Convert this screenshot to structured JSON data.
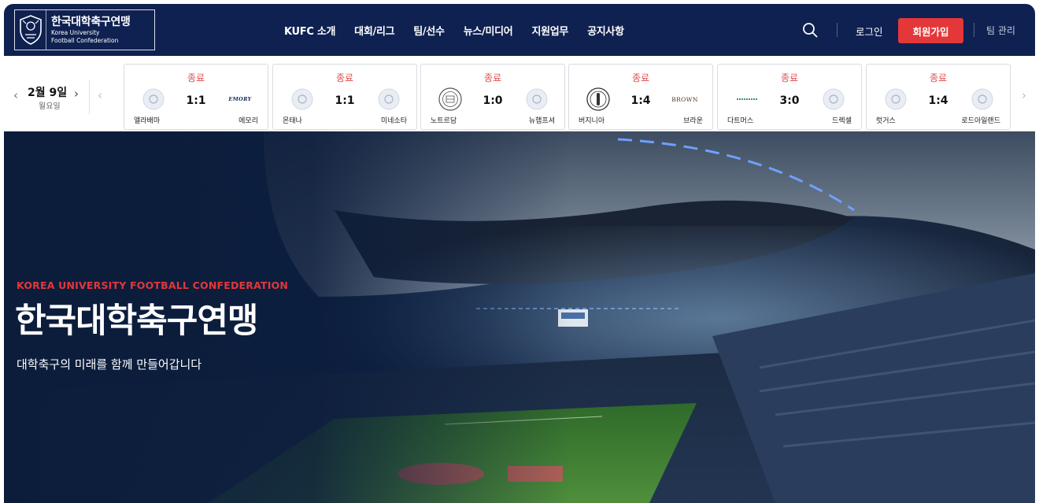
{
  "header": {
    "logo": {
      "name_ko": "한국대학축구연맹",
      "name_en_line1": "Korea University",
      "name_en_line2": "Football Confederation",
      "emblem_icon": "shield-emblem-icon"
    },
    "nav": [
      {
        "label": "KUFC 소개"
      },
      {
        "label": "대회/리그"
      },
      {
        "label": "팀/선수"
      },
      {
        "label": "뉴스/미디어"
      },
      {
        "label": "지원업무"
      },
      {
        "label": "공지사항"
      }
    ],
    "search_icon": "search-icon",
    "login_label": "로그인",
    "signup_label": "회원가입",
    "team_admin_label": "팀 관리"
  },
  "scores": {
    "date": "2월 9일",
    "weekday": "월요일",
    "matches": [
      {
        "status": "종료",
        "home": "앨라배마",
        "away": "에모리",
        "score": "1:1",
        "home_logo": "placeholder-logo-icon",
        "away_logo": "emory-logo-icon",
        "away_logo_text": "EMORY"
      },
      {
        "status": "종료",
        "home": "몬태나",
        "away": "미네소타",
        "score": "1:1",
        "home_logo": "placeholder-logo-icon",
        "away_logo": "placeholder-logo-icon"
      },
      {
        "status": "종료",
        "home": "노트르담",
        "away": "뉴햄프셔",
        "score": "1:0",
        "home_logo": "notre-dame-seal-icon",
        "away_logo": "placeholder-logo-icon"
      },
      {
        "status": "종료",
        "home": "버지니아",
        "away": "브라운",
        "score": "1:4",
        "home_logo": "virginia-seal-icon",
        "away_logo": "brown-logo-icon",
        "away_logo_text": "BROWN"
      },
      {
        "status": "종료",
        "home": "다트머스",
        "away": "드렉셀",
        "score": "3:0",
        "home_logo": "dartmouth-logo-icon",
        "away_logo": "placeholder-logo-icon"
      },
      {
        "status": "종료",
        "home": "럿거스",
        "away": "로드아일랜드",
        "score": "1:4",
        "home_logo": "placeholder-logo-icon",
        "away_logo": "placeholder-logo-icon"
      }
    ]
  },
  "hero": {
    "kicker": "KOREA UNIVERSITY FOOTBALL CONFEDERATION",
    "title": "한국대학축구연맹",
    "subtitle": "대학축구의 미래를 함께 만들어갑니다"
  },
  "colors": {
    "header_bg": "#0e2150",
    "accent_red": "#e3373a",
    "status_red": "#e04f4f"
  }
}
